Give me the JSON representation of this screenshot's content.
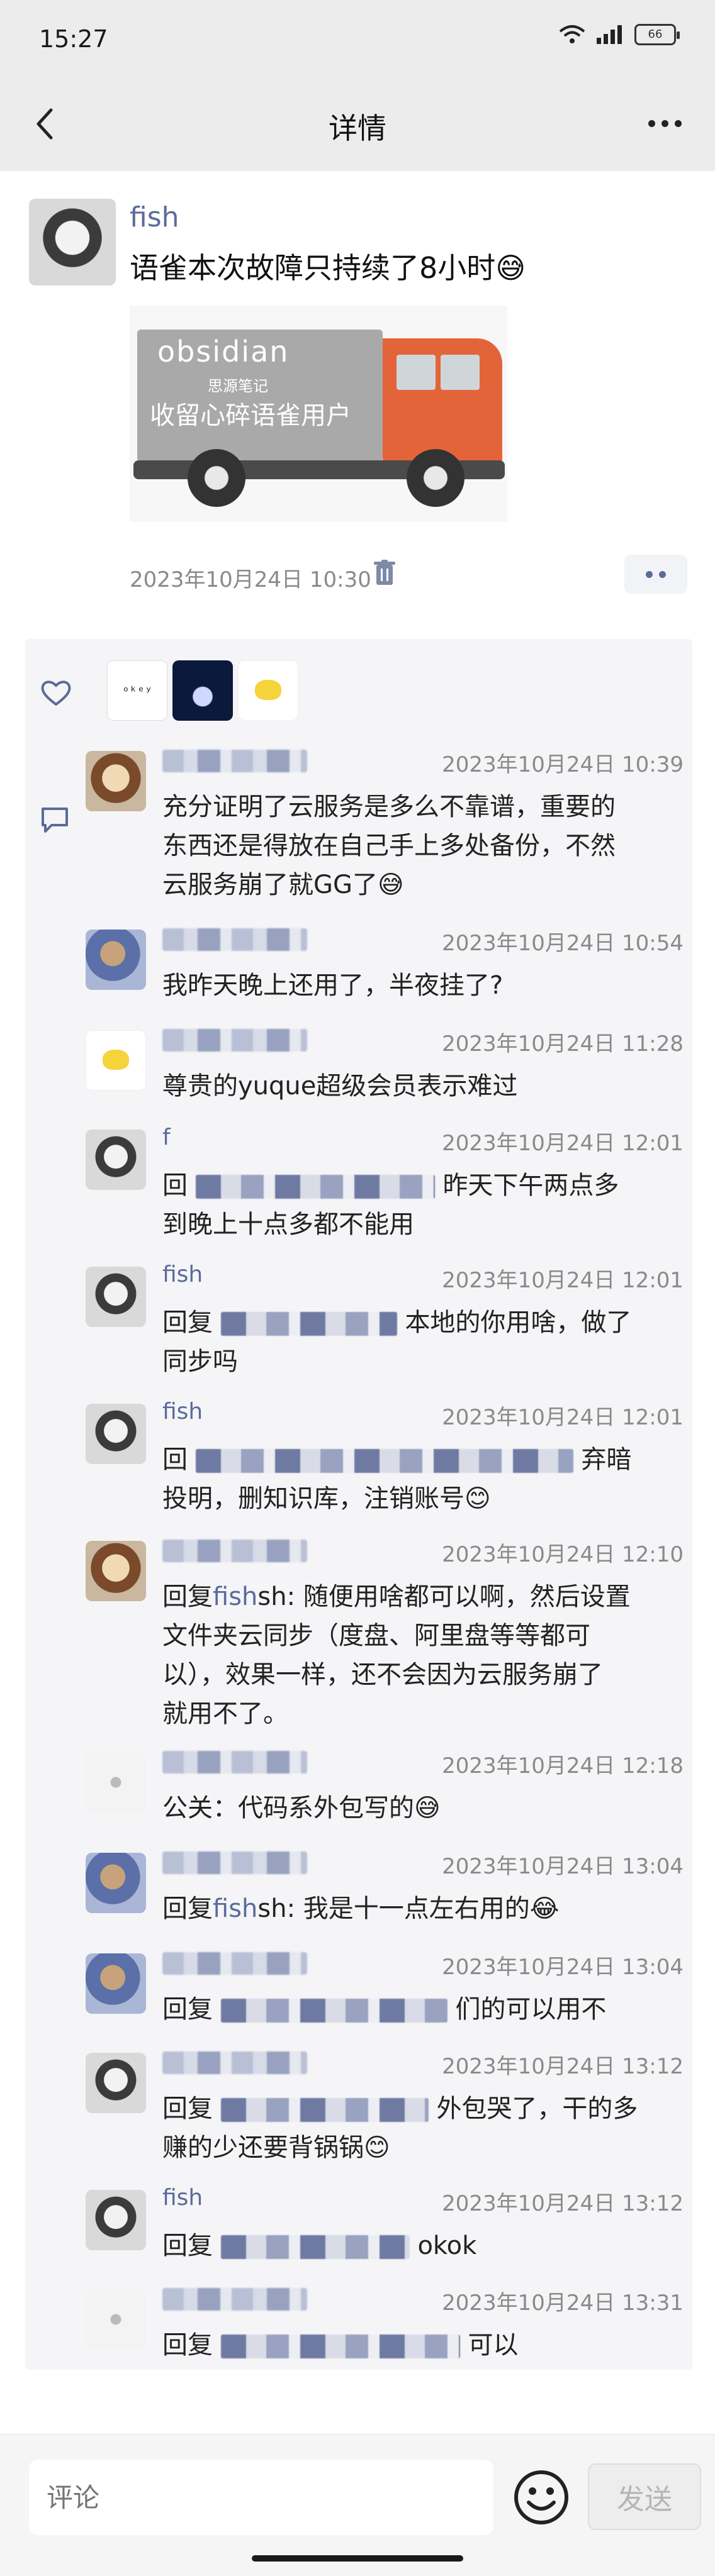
{
  "status_bar": {
    "time": "15:27",
    "battery": "66",
    "signal": "5G"
  },
  "header": {
    "title": "详情"
  },
  "post": {
    "author": "fish",
    "text": "语雀本次故障只持续了8小时😅",
    "image": {
      "title": "obsidian",
      "subtitle": "思源笔记",
      "slogan": "收留心碎语雀用户"
    },
    "timestamp": "2023年10月24日 10:30"
  },
  "comments": [
    {
      "author": "",
      "time": "2023年10月24日 10:39",
      "lines": [
        "充分证明了云服务是多么不靠谱，重要的",
        "东西还是得放在自己手上多处备份，不然",
        "云服务崩了就GG了😅"
      ],
      "avatar": "cat"
    },
    {
      "author": "",
      "time": "2023年10月24日 10:54",
      "lines": [
        "我昨天晚上还用了，半夜挂了?"
      ],
      "avatar": "blue"
    },
    {
      "author": "",
      "time": "2023年10月24日 11:28",
      "lines": [
        "尊贵的yuque超级会员表示难过"
      ],
      "avatar": "pika"
    },
    {
      "author": "f",
      "time": "2023年10月24日 12:01",
      "prefix": "回",
      "suffix": "昨天下午两点多",
      "lines": [
        "到晚上十点多都不能用"
      ],
      "avatar": "dog"
    },
    {
      "author": "fish",
      "time": "2023年10月24日 12:01",
      "prefix": "回复",
      "suffix": "本地的你用啥，做了",
      "lines": [
        "同步吗"
      ],
      "avatar": "dog"
    },
    {
      "author": "fish",
      "time": "2023年10月24日 12:01",
      "prefix": "回",
      "suffix": "弃暗",
      "lines": [
        "投明，删知识库，注销账号😊"
      ],
      "avatar": "dog"
    },
    {
      "author": "",
      "time": "2023年10月24日 12:10",
      "lines": [
        "回复fish: 随便用啥都可以啊，然后设置",
        "文件夹云同步（度盘、阿里盘等等都可",
        "以），效果一样，还不会因为云服务崩了",
        "就用不了。"
      ],
      "reply_to": "fish",
      "avatar": "cat"
    },
    {
      "author": "",
      "time": "2023年10月24日 12:18",
      "lines": [
        "公关：代码系外包写的😅"
      ],
      "avatar": "sketch"
    },
    {
      "author": "",
      "time": "2023年10月24日 13:04",
      "lines": [
        "回复fish: 我是十一点左右用的😂"
      ],
      "reply_to": "fish",
      "avatar": "blue"
    },
    {
      "author": "",
      "time": "2023年10月24日 13:04",
      "prefix": "回复",
      "suffix": "们的可以用不",
      "lines": [],
      "avatar": "blue"
    },
    {
      "author": "",
      "time": "2023年10月24日 13:12",
      "prefix": "回复",
      "suffix": "外包哭了，干的多",
      "lines": [
        "赚的少还要背锅锅😊"
      ],
      "avatar": "dog"
    },
    {
      "author": "fish",
      "time": "2023年10月24日 13:12",
      "prefix": "回复",
      "suffix": "okok",
      "lines": [],
      "avatar": "dog"
    },
    {
      "author": "",
      "time": "2023年10月24日 13:31",
      "prefix": "回复",
      "suffix": "可以",
      "lines": [],
      "avatar": "sketch"
    }
  ],
  "input": {
    "placeholder": "评论",
    "send_label": "发送"
  },
  "icons": [
    "back-arrow-icon",
    "more-icon",
    "trash-icon",
    "heart-icon",
    "comment-icon",
    "emoji-icon",
    "wifi-icon",
    "signal-icon",
    "battery-icon"
  ],
  "colors": {
    "link": "#5b6b9a",
    "meta": "#8a8a8a",
    "truck_cab": "#e4643a",
    "panel_bg": "#f5f5f7"
  }
}
